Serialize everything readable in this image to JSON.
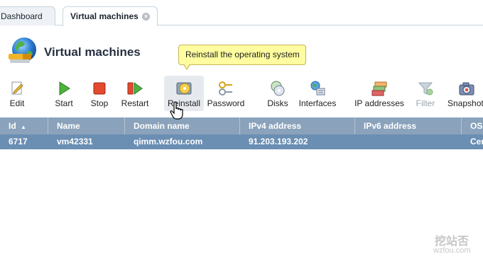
{
  "tabs": [
    {
      "label": "Dashboard",
      "active": false
    },
    {
      "label": "Virtual machines",
      "active": true
    }
  ],
  "page": {
    "title": "Virtual machines",
    "tooltip": "Reinstall the operating system"
  },
  "toolbar": [
    {
      "label": "Edit",
      "icon": "edit-icon"
    },
    {
      "label": "Start",
      "icon": "play-icon"
    },
    {
      "label": "Stop",
      "icon": "stop-icon"
    },
    {
      "label": "Restart",
      "icon": "restart-icon"
    },
    {
      "label": "Reinstall",
      "icon": "reinstall-icon"
    },
    {
      "label": "Password",
      "icon": "key-icon"
    },
    {
      "label": "Disks",
      "icon": "disks-icon"
    },
    {
      "label": "Interfaces",
      "icon": "interfaces-icon"
    },
    {
      "label": "IP addresses",
      "icon": "ip-addresses-icon"
    },
    {
      "label": "Filter",
      "icon": "filter-icon"
    },
    {
      "label": "Snapshot",
      "icon": "snapshot-icon"
    }
  ],
  "table": {
    "columns": [
      "Id",
      "Name",
      "Domain name",
      "IPv4 address",
      "IPv6 address",
      "OS"
    ],
    "sort_indicator": "▲",
    "rows": [
      {
        "id": "6717",
        "name": "vm42331",
        "domain": "qimm.wzfou.com",
        "ipv4": "91.203.193.202",
        "ipv6": "",
        "os": "Cen"
      }
    ]
  },
  "watermark": {
    "line1": "挖站否",
    "line2": "wzfou.com"
  },
  "colors": {
    "header": "#8aa2bb",
    "selected_row": "#6b8eb3",
    "tooltip": "#fffd9f"
  }
}
